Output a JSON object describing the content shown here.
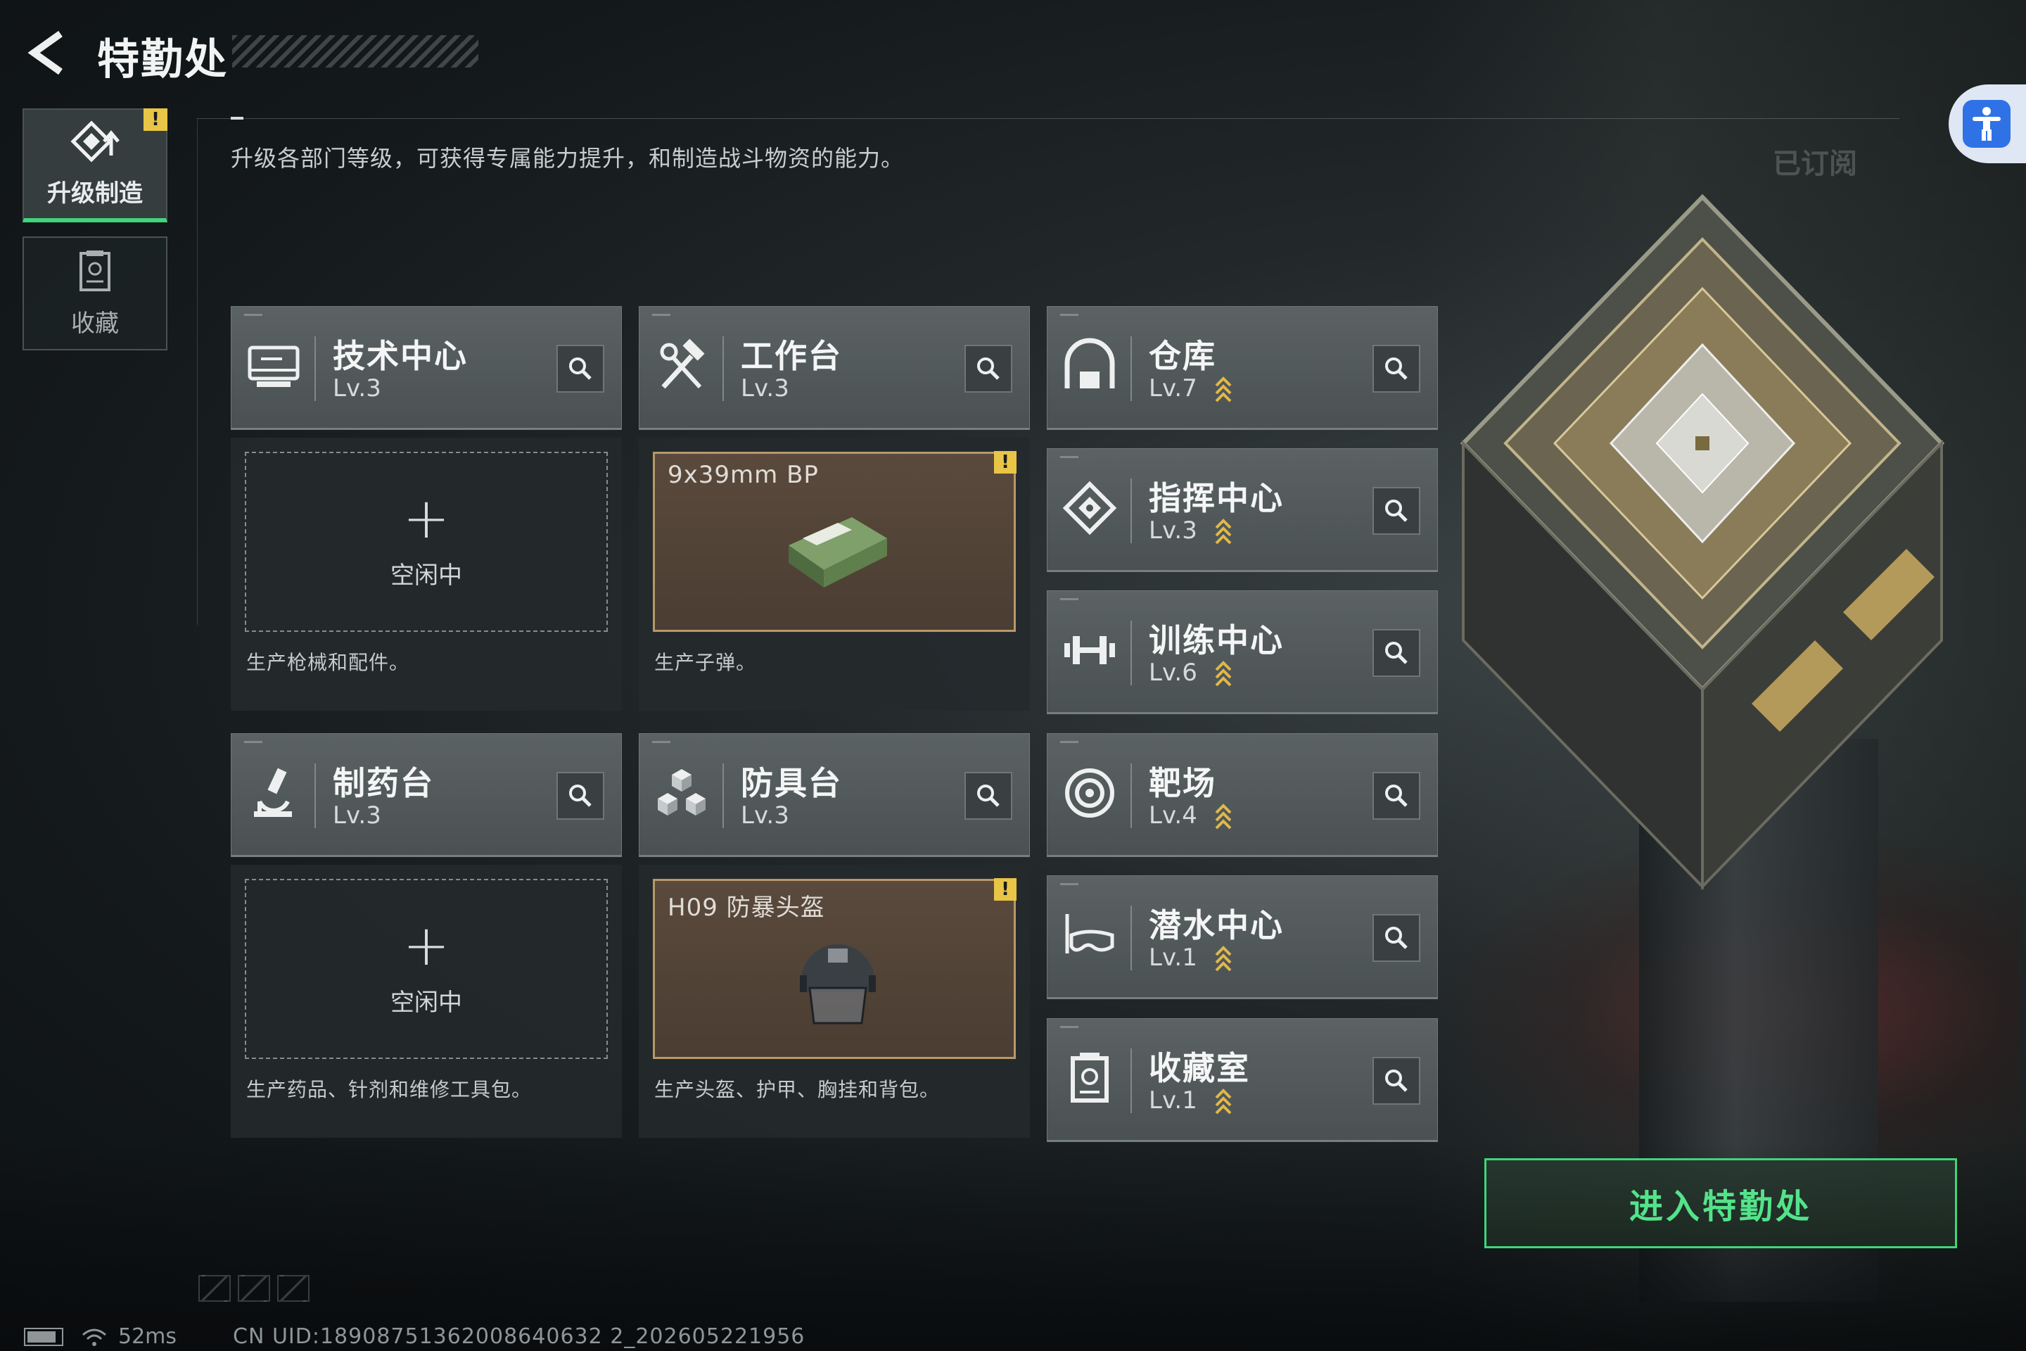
{
  "header": {
    "title": "特勤处"
  },
  "description": "升级各部门等级，可获得专属能力提升，和制造战斗物资的能力。",
  "subscribed_label": "已订阅",
  "sidebar": {
    "items": [
      {
        "label": "升级制造",
        "active": true,
        "warning": "!"
      },
      {
        "label": "收藏",
        "active": false
      }
    ]
  },
  "production_departments": [
    {
      "name": "技术中心",
      "level": "Lv.3",
      "slot_state": "空闲中",
      "description": "生产枪械和配件。"
    },
    {
      "name": "工作台",
      "level": "Lv.3",
      "slot_item": "9x39mm BP",
      "warning": "!",
      "description": "生产子弹。"
    },
    {
      "name": "制药台",
      "level": "Lv.3",
      "slot_state": "空闲中",
      "description": "生产药品、针剂和维修工具包。"
    },
    {
      "name": "防具台",
      "level": "Lv.3",
      "slot_item": "H09 防暴头盔",
      "warning": "!",
      "description": "生产头盔、护甲、胸挂和背包。"
    }
  ],
  "facilities": [
    {
      "name": "仓库",
      "level": "Lv.7",
      "icon": "warehouse-icon"
    },
    {
      "name": "指挥中心",
      "level": "Lv.3",
      "icon": "command-icon"
    },
    {
      "name": "训练中心",
      "level": "Lv.6",
      "icon": "dumbbell-icon"
    },
    {
      "name": "靶场",
      "level": "Lv.4",
      "icon": "target-icon"
    },
    {
      "name": "潜水中心",
      "level": "Lv.1",
      "icon": "diving-mask-icon"
    },
    {
      "name": "收藏室",
      "level": "Lv.1",
      "icon": "trophy-icon"
    }
  ],
  "enter_button": "进入特勤处",
  "status_bar": {
    "latency": "52ms",
    "uid": "CN UID:18908751362008640632 2_202605221956"
  },
  "colors": {
    "accent_green": "#3fd57a",
    "warning_yellow": "#e8c547",
    "upgrade_arrow": "#e0b84a",
    "a11y_blue": "#2f72e6"
  }
}
